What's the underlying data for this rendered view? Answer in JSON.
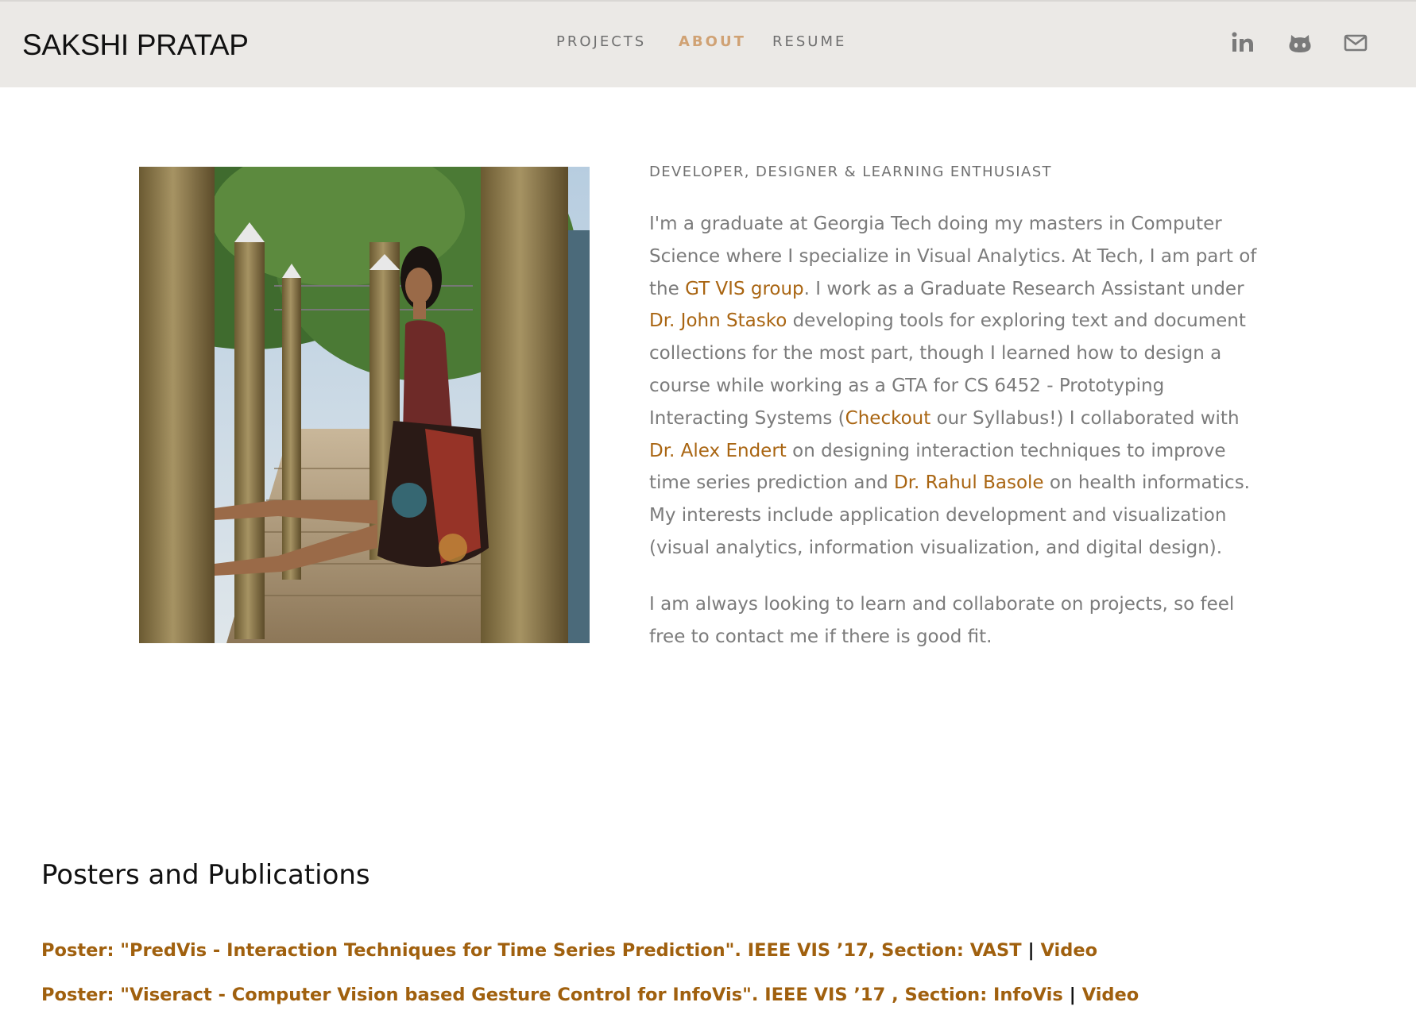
{
  "header": {
    "brand": "SAKSHI PRATAP",
    "nav": [
      {
        "label": "PROJECTS",
        "active": false
      },
      {
        "label": "ABOUT",
        "active": true
      },
      {
        "label": "RESUME",
        "active": false
      }
    ],
    "social_icons": [
      "linkedin-icon",
      "github-icon",
      "mail-icon"
    ]
  },
  "about": {
    "tagline": "DEVELOPER, DESIGNER & LEARNING ENTHUSIAST",
    "bio1": {
      "t1": "I'm a graduate at Georgia Tech doing my masters in Computer Science where I specialize in Visual Analytics. At Tech, I am part of the ",
      "link1": "GT VIS group",
      "t2": ". I work as a Graduate Research Assistant under ",
      "link2": "Dr. John Stasko",
      "t3": " developing tools for exploring text and document collections for the most part, though I learned how to design a course while working as a GTA for CS 6452 - Prototyping Interacting Systems (",
      "link3": "Checkout",
      "t4": " our Syllabus!) I collaborated with ",
      "link4": "Dr. Alex Endert",
      "t5": " on designing interaction techniques to improve time series prediction and ",
      "link5": "Dr. Rahul Basole",
      "t6": " on health informatics. My interests include application development and visualization (visual analytics, information visualization, and digital design)."
    },
    "bio2": "I am always looking to learn and collaborate on projects, so feel free to contact me if there is good fit."
  },
  "publications": {
    "title": "Posters and Publications",
    "items": [
      {
        "text": "Poster: \"PredVis - Interaction Techniques for Time Series Prediction\". IEEE VIS ’17, Section: VAST",
        "sep": "|",
        "video": "Video"
      },
      {
        "text": "Poster: \"Viseract - Computer Vision based Gesture Control for InfoVis\". IEEE VIS ’17 , Section: InfoVis",
        "sep": "|",
        "video": "Video"
      }
    ]
  },
  "colors": {
    "header_bg": "#ebe9e6",
    "accent": "#d0a274",
    "link": "#a96512",
    "body_text": "#7b7b7b"
  }
}
